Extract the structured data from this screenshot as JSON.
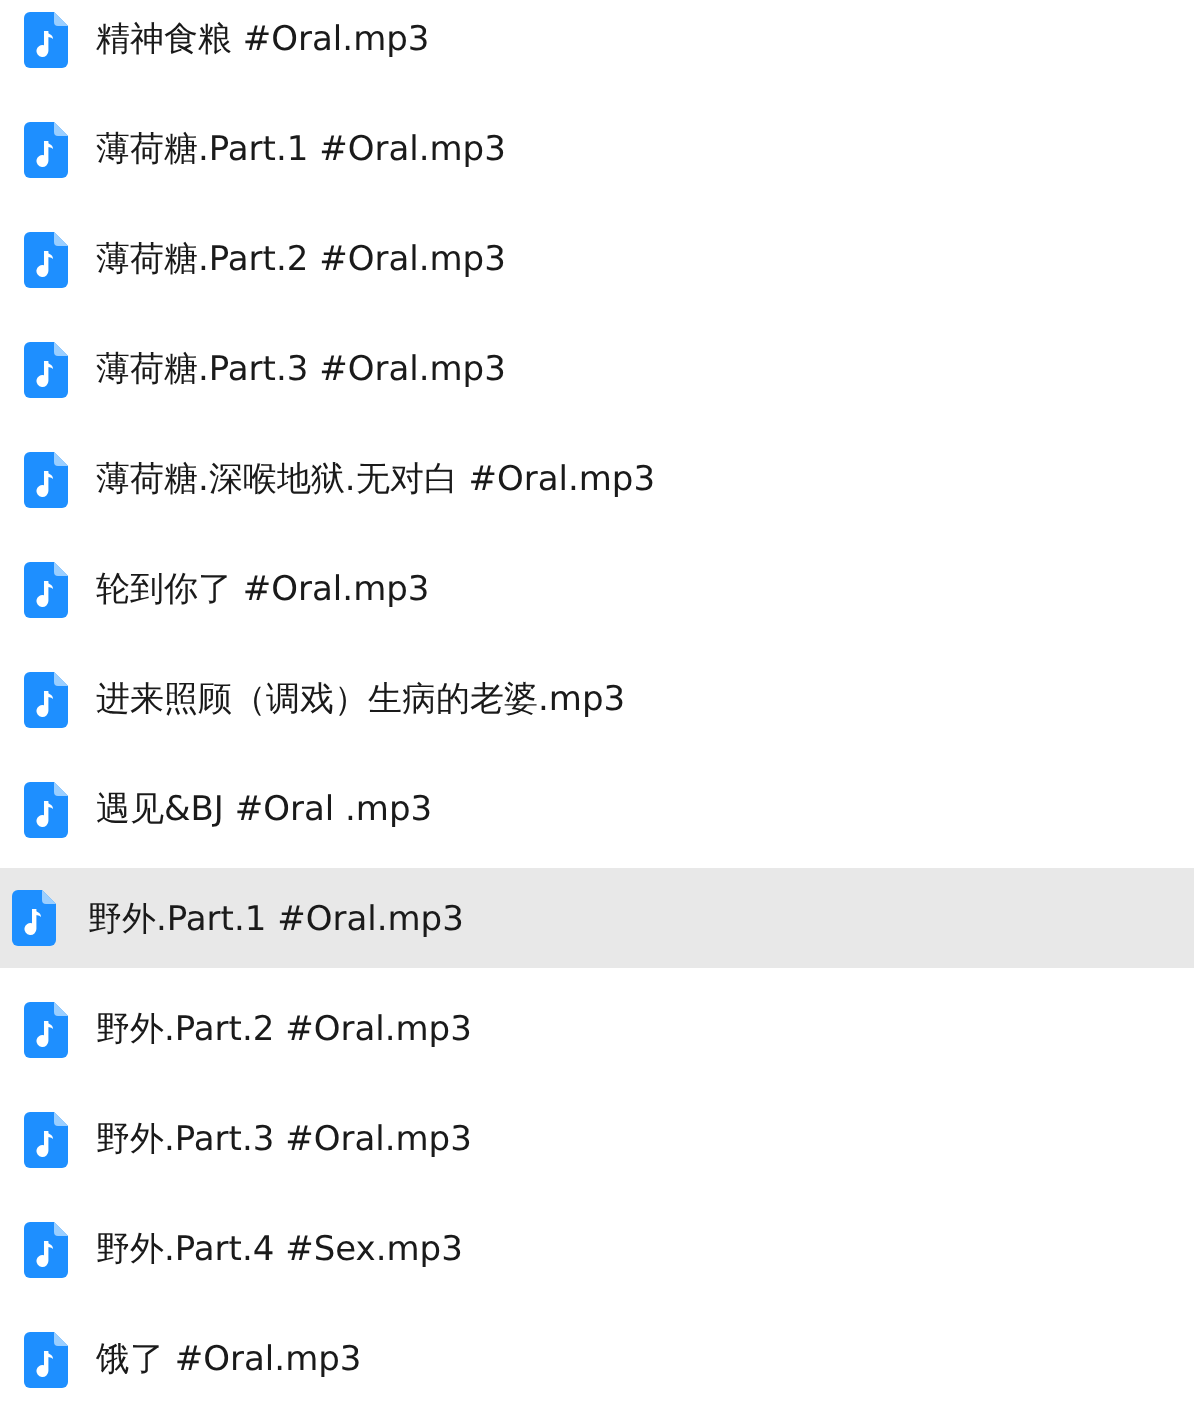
{
  "files": [
    {
      "name": "精神食粮 #Oral.mp3",
      "selected": false
    },
    {
      "name": "薄荷糖.Part.1 #Oral.mp3",
      "selected": false
    },
    {
      "name": "薄荷糖.Part.2 #Oral.mp3",
      "selected": false
    },
    {
      "name": "薄荷糖.Part.3 #Oral.mp3",
      "selected": false
    },
    {
      "name": "薄荷糖.深喉地狱.无对白 #Oral.mp3",
      "selected": false
    },
    {
      "name": "轮到你了 #Oral.mp3",
      "selected": false
    },
    {
      "name": "进来照顾（调戏）生病的老婆.mp3",
      "selected": false
    },
    {
      "name": "遇见&BJ #Oral .mp3",
      "selected": false
    },
    {
      "name": "野外.Part.1 #Oral.mp3",
      "selected": true
    },
    {
      "name": "野外.Part.2 #Oral.mp3",
      "selected": false
    },
    {
      "name": "野外.Part.3 #Oral.mp3",
      "selected": false
    },
    {
      "name": "野外.Part.4 #Sex.mp3",
      "selected": false
    },
    {
      "name": "饿了 #Oral.mp3",
      "selected": false
    }
  ]
}
